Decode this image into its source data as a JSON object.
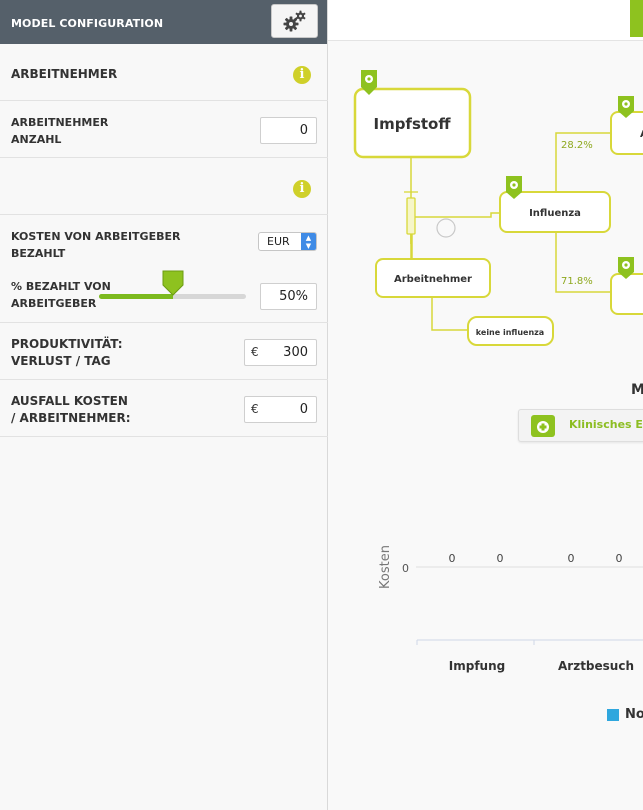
{
  "sidebar": {
    "title": "MODEL CONFIGURATION",
    "section_title": "ARBEITNEHMER",
    "employees_label_line1": "ARBEITNEHMER",
    "employees_label_line2": "ANZAHL",
    "employees_value": "0",
    "cost_label_line1": "KOSTEN VON ARBEITGEBER",
    "cost_label_line2": "BEZAHLT",
    "currency": "EUR",
    "paid_label_line1": "% BEZAHLT VON",
    "paid_label_line2": "ARBEITGEBER",
    "paid_fraction": 0.5,
    "paid_value": "50%",
    "prod_label_line1": "PRODUKTIVITÄT:",
    "prod_label_line2": "VERLUST / TAG",
    "prod_currency": "€",
    "prod_value": "300",
    "absence_label_line1": "AUSFALL KOSTEN",
    "absence_label_line2": "/ ARBEITNEHMER:",
    "absence_currency": "€",
    "absence_value": "0",
    "info_symbol": "i"
  },
  "diagram": {
    "node_impfstoff": "Impfstoff",
    "node_influenza": "Influenza",
    "node_arbeitnehmer": "Arbeitnehmer",
    "node_keine_influenza": "keine influenza",
    "node_partial": "A",
    "pct_top": "28.2%",
    "pct_bottom": "71.8%"
  },
  "results": {
    "title_partial": "M",
    "clinical_button": "Klinisches Erg",
    "legend_label": "No"
  },
  "chart_data": {
    "type": "bar",
    "ylabel": "Kosten",
    "y_ticks": [
      "0"
    ],
    "categories": [
      "Impfung",
      "Arztbesuch"
    ],
    "bar_labels": [
      "0",
      "0",
      "0",
      "0"
    ],
    "series": [
      {
        "name": "No",
        "color": "#2fa7de",
        "values": [
          0,
          0,
          0,
          0
        ]
      }
    ]
  },
  "colors": {
    "accent_green": "#8ec21f",
    "node_border": "#d8d83a",
    "header_bg": "#55606a",
    "legend_blue": "#2fa7de"
  }
}
